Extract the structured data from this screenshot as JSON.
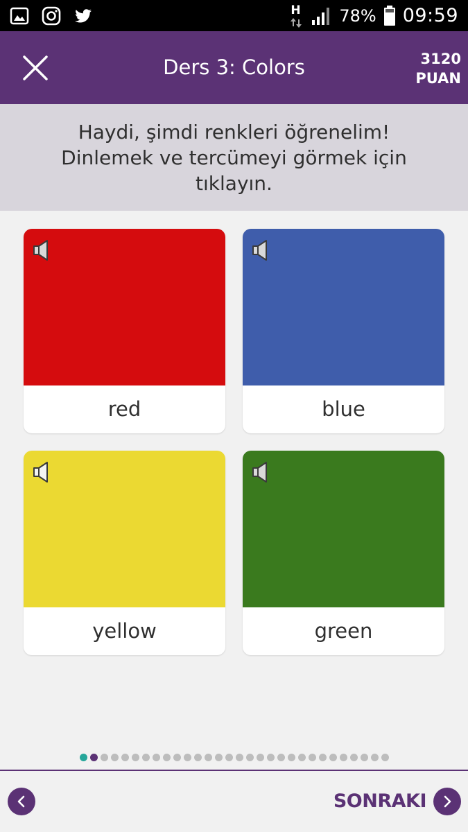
{
  "status_bar": {
    "battery": "78%",
    "time": "09:59",
    "network": "H",
    "left_icons": [
      "gallery-icon",
      "instagram-icon",
      "twitter-icon"
    ]
  },
  "header": {
    "title": "Ders 3: Colors",
    "score_value": "3120",
    "score_unit": "PUAN",
    "background": "#5b3275"
  },
  "instruction": {
    "line1": "Haydi, şimdi renkleri öğrenelim!",
    "line2": "Dinlemek ve tercümeyi görmek için",
    "line3": "tıklayın."
  },
  "cards": [
    {
      "label": "red",
      "color": "#d50c0e"
    },
    {
      "label": "blue",
      "color": "#3f5dab"
    },
    {
      "label": "yellow",
      "color": "#ebd932"
    },
    {
      "label": "green",
      "color": "#3a7a1e"
    }
  ],
  "pager": {
    "total": 30,
    "completed": 1,
    "current": 2,
    "colors": {
      "completed": "#26a69a",
      "current": "#5b3275",
      "inactive": "#bdbdbd"
    }
  },
  "footer": {
    "next_label": "SONRAKI",
    "accent": "#5b3275"
  }
}
